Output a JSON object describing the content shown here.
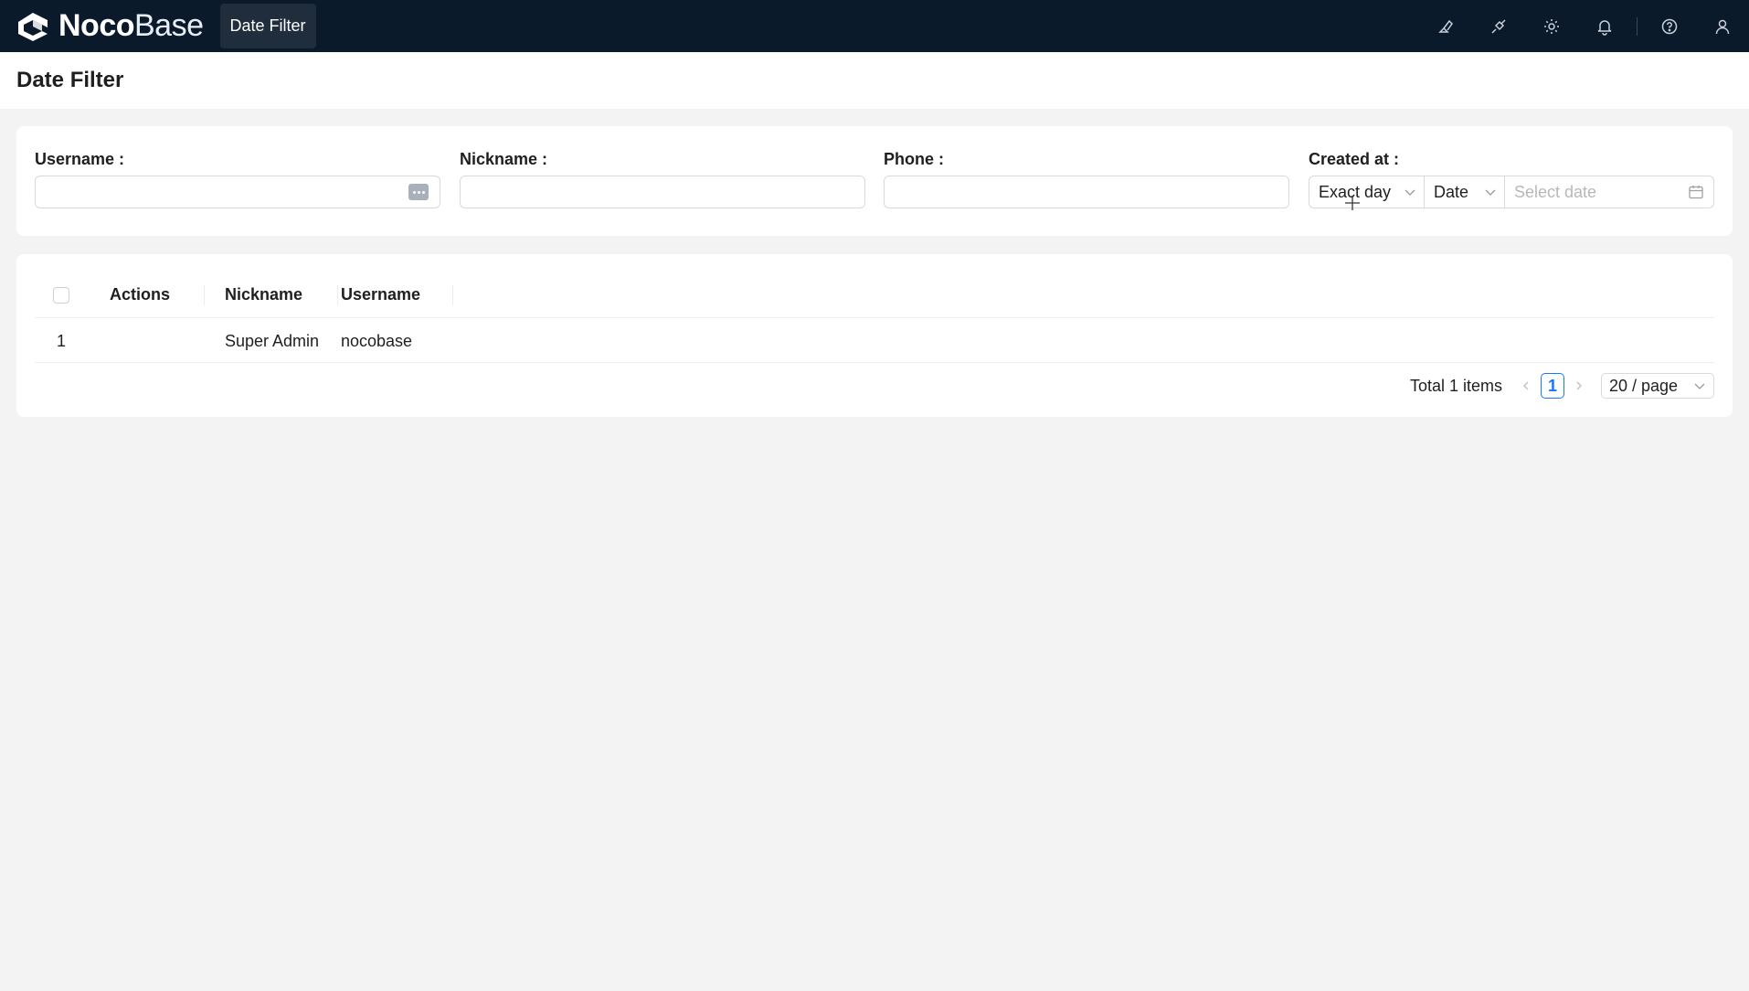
{
  "app": {
    "logo_bold": "Noco",
    "logo_light": "Base",
    "menu_tab": "Date Filter",
    "icons": [
      "highlighter-icon",
      "plugin-icon",
      "settings-icon",
      "bell-icon",
      "help-icon",
      "user-icon"
    ]
  },
  "page": {
    "title": "Date Filter"
  },
  "filter": {
    "username_label": "Username",
    "nickname_label": "Nickname",
    "phone_label": "Phone",
    "created_at_label": "Created at",
    "username_value": "",
    "nickname_value": "",
    "phone_value": "",
    "created_mode": "Exact day",
    "created_picker": "Date",
    "date_placeholder": "Select date"
  },
  "table": {
    "columns": [
      "Actions",
      "Nickname",
      "Username"
    ],
    "rows": [
      {
        "index": "1",
        "actions": "",
        "nickname": "Super Admin",
        "username": "nocobase"
      }
    ]
  },
  "pagination": {
    "total": "Total 1 items",
    "current": "1",
    "page_size": "20 / page"
  },
  "colors": {
    "topbar": "#0b1a2b",
    "accent": "#1677ff",
    "background": "#f3f3f3"
  }
}
